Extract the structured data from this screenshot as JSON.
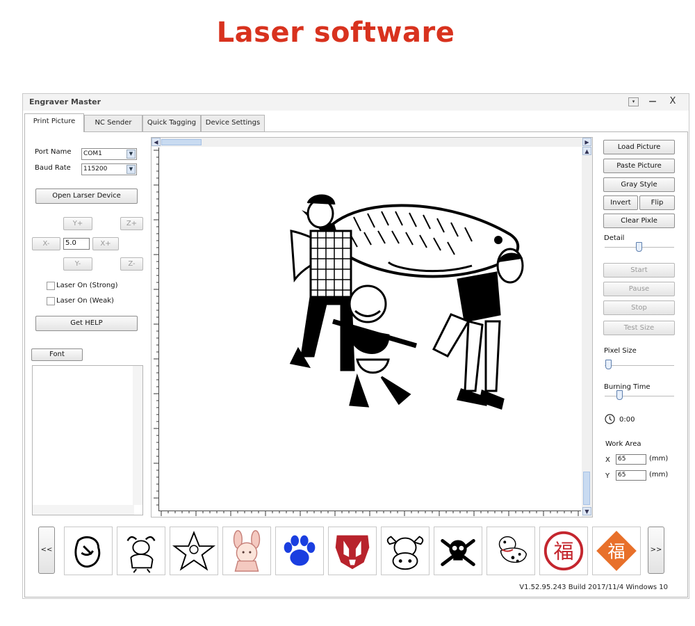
{
  "hero_title": "Laser software",
  "window": {
    "title": "Engraver Master",
    "controls": {
      "dropdown": "▾",
      "minimize": "—",
      "close": "X"
    }
  },
  "tabs": [
    {
      "label": "Print Picture",
      "active": true
    },
    {
      "label": "NC Sender",
      "active": false
    },
    {
      "label": "Quick Tagging",
      "active": false
    },
    {
      "label": "Device Settings",
      "active": false
    }
  ],
  "connection": {
    "port_label": "Port Name",
    "port_value": "COM1",
    "baud_label": "Baud Rate",
    "baud_value": "115200",
    "open_button": "Open Larser Device"
  },
  "jog": {
    "y_plus": "Y+",
    "z_plus": "Z+",
    "x_minus": "X-",
    "step_value": "5.0",
    "x_plus": "X+",
    "y_minus": "Y-",
    "z_minus": "Z-"
  },
  "laser": {
    "strong_label": "Laser On (Strong)",
    "weak_label": "Laser On (Weak)",
    "help_button": "Get HELP"
  },
  "font_button": "Font",
  "right_panel": {
    "load_picture": "Load Picture",
    "paste_picture": "Paste Picture",
    "gray_style": "Gray Style",
    "invert": "Invert",
    "flip": "Flip",
    "clear_pixle": "Clear Pixle",
    "detail_label": "Detail",
    "detail_level": 0.5,
    "start": "Start",
    "pause": "Pause",
    "stop": "Stop",
    "test_size": "Test Size",
    "pixel_size_label": "Pixel Size",
    "pixel_size_level": 0.02,
    "burning_time_label": "Burning Time",
    "burning_time_level": 0.2,
    "timer_value": "0:00",
    "work_area_label": "Work Area",
    "x_label": "X",
    "x_value": "65",
    "y_label": "Y",
    "y_value": "65",
    "unit": "(mm)"
  },
  "gallery": {
    "prev": "<<",
    "next": ">>",
    "items": [
      {
        "icon": "pointing-hand-icon"
      },
      {
        "icon": "bull-icon"
      },
      {
        "icon": "star-warrior-icon"
      },
      {
        "icon": "bunny-girl-icon"
      },
      {
        "icon": "paw-print-icon"
      },
      {
        "icon": "autobot-logo-icon"
      },
      {
        "icon": "cow-face-icon"
      },
      {
        "icon": "skull-crossbones-icon"
      },
      {
        "icon": "dalmatian-icon"
      },
      {
        "icon": "fu-seal-icon",
        "text": "福"
      },
      {
        "icon": "fu-diamond-icon",
        "text": "福"
      }
    ]
  },
  "status_text": "V1.52.95.243 Build 2017/11/4 Windows 10",
  "colors": {
    "hero": "#d8321e",
    "paw": "#1a3ee0",
    "autobot": "#b8232c",
    "fu_seal": "#c4262e",
    "fu_diamond": "#e8702a"
  }
}
